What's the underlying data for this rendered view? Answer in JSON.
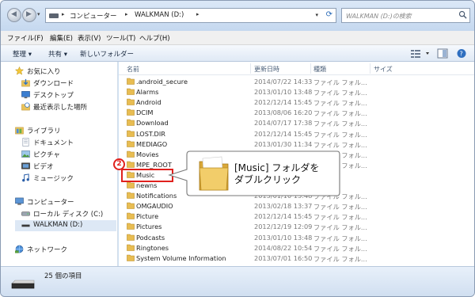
{
  "window": {
    "breadcrumb": [
      "コンピューター",
      "WALKMAN (D:)"
    ],
    "search_placeholder": "WALKMAN (D:)の検索"
  },
  "menu": [
    "ファイル(F)",
    "編集(E)",
    "表示(V)",
    "ツール(T)",
    "ヘルプ(H)"
  ],
  "toolbar": {
    "organize": "整理 ▾",
    "share": "共有 ▾",
    "new_folder": "新しいフォルダー"
  },
  "nav": {
    "favorites": "お気に入り",
    "downloads": "ダウンロード",
    "desktop": "デスクトップ",
    "recent": "最近表示した場所",
    "libraries": "ライブラリ",
    "documents": "ドキュメント",
    "pictures": "ピクチャ",
    "videos": "ビデオ",
    "music": "ミュージック",
    "computer": "コンピューター",
    "local_disk": "ローカル ディスク (C:)",
    "walkman": "WALKMAN (D:)",
    "network": "ネットワーク"
  },
  "columns": {
    "name": "名前",
    "date": "更新日時",
    "type": "種類",
    "size": "サイズ"
  },
  "files": [
    {
      "name": ".android_secure",
      "date": "2014/07/22 14:33",
      "type": "ファイル フォル..."
    },
    {
      "name": "Alarms",
      "date": "2013/01/10 13:48",
      "type": "ファイル フォル..."
    },
    {
      "name": "Android",
      "date": "2012/12/14 15:45",
      "type": "ファイル フォル..."
    },
    {
      "name": "DCIM",
      "date": "2013/08/06 16:20",
      "type": "ファイル フォル..."
    },
    {
      "name": "Download",
      "date": "2014/07/17 17:38",
      "type": "ファイル フォル..."
    },
    {
      "name": "LOST.DIR",
      "date": "2012/12/14 15:45",
      "type": "ファイル フォル..."
    },
    {
      "name": "MEDIAGO",
      "date": "2013/01/30 11:34",
      "type": "ファイル フォル..."
    },
    {
      "name": "Movies",
      "date": "2013/01/10 13:48",
      "type": "ファイル フォル..."
    },
    {
      "name": "MPE_ROOT",
      "date": "2012/12/14 15:45",
      "type": "ファイル フォル..."
    },
    {
      "name": "Music",
      "date": "",
      "type": ""
    },
    {
      "name": "newns",
      "date": "",
      "type": ""
    },
    {
      "name": "Notifications",
      "date": "2013/01/10 13:48",
      "type": "ファイル フォル..."
    },
    {
      "name": "OMGAUDIO",
      "date": "2013/02/18 13:37",
      "type": "ファイル フォル..."
    },
    {
      "name": "Picture",
      "date": "2012/12/14 15:45",
      "type": "ファイル フォル..."
    },
    {
      "name": "Pictures",
      "date": "2012/12/19 12:09",
      "type": "ファイル フォル..."
    },
    {
      "name": "Podcasts",
      "date": "2013/01/10 13:48",
      "type": "ファイル フォル..."
    },
    {
      "name": "Ringtones",
      "date": "2014/08/22 10:54",
      "type": "ファイル フォル..."
    },
    {
      "name": "System Volume Information",
      "date": "2013/07/01 16:50",
      "type": "ファイル フォル..."
    }
  ],
  "status": {
    "count": "25 個の項目"
  },
  "annotation": {
    "step": "2",
    "line1": "[Music] フォルダを",
    "line2": "ダブルクリック"
  }
}
